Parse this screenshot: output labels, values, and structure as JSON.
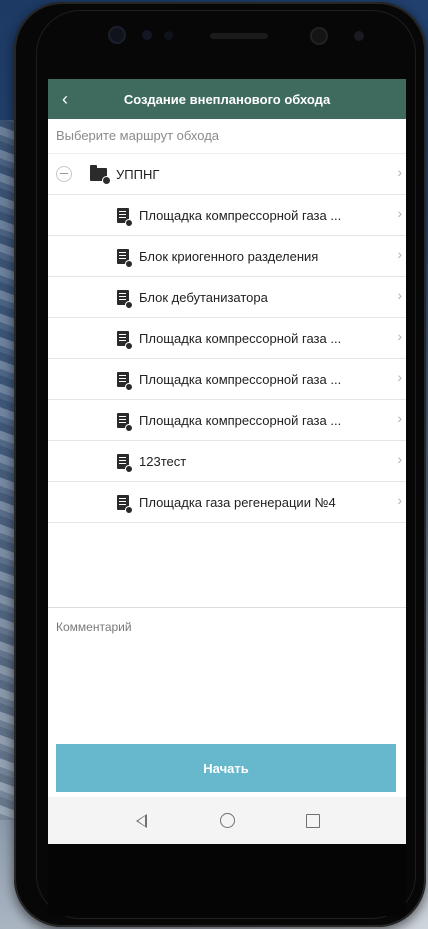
{
  "appbar": {
    "title": "Создание внепланового обхода",
    "back_icon": "chevron-left-icon"
  },
  "route_prompt": "Выберите маршрут обхода",
  "tree": {
    "root": {
      "label": "УППНГ",
      "icon": "folder-icon",
      "expanded": true
    },
    "children": [
      {
        "label": "Площадка компрессорной газа ..."
      },
      {
        "label": "Блок криогенного разделения"
      },
      {
        "label": "Блок дебутанизатора"
      },
      {
        "label": "Площадка компрессорной газа ..."
      },
      {
        "label": "Площадка компрессорной газа ..."
      },
      {
        "label": "Площадка компрессорной газа ..."
      },
      {
        "label": "123тест"
      },
      {
        "label": "Площадка газа регенерации №4"
      }
    ]
  },
  "comment": {
    "label": "Комментарий",
    "value": ""
  },
  "start_button": {
    "label": "Начать"
  },
  "colors": {
    "appbar": "#3f6b5f",
    "start_button": "#67b8cc"
  }
}
